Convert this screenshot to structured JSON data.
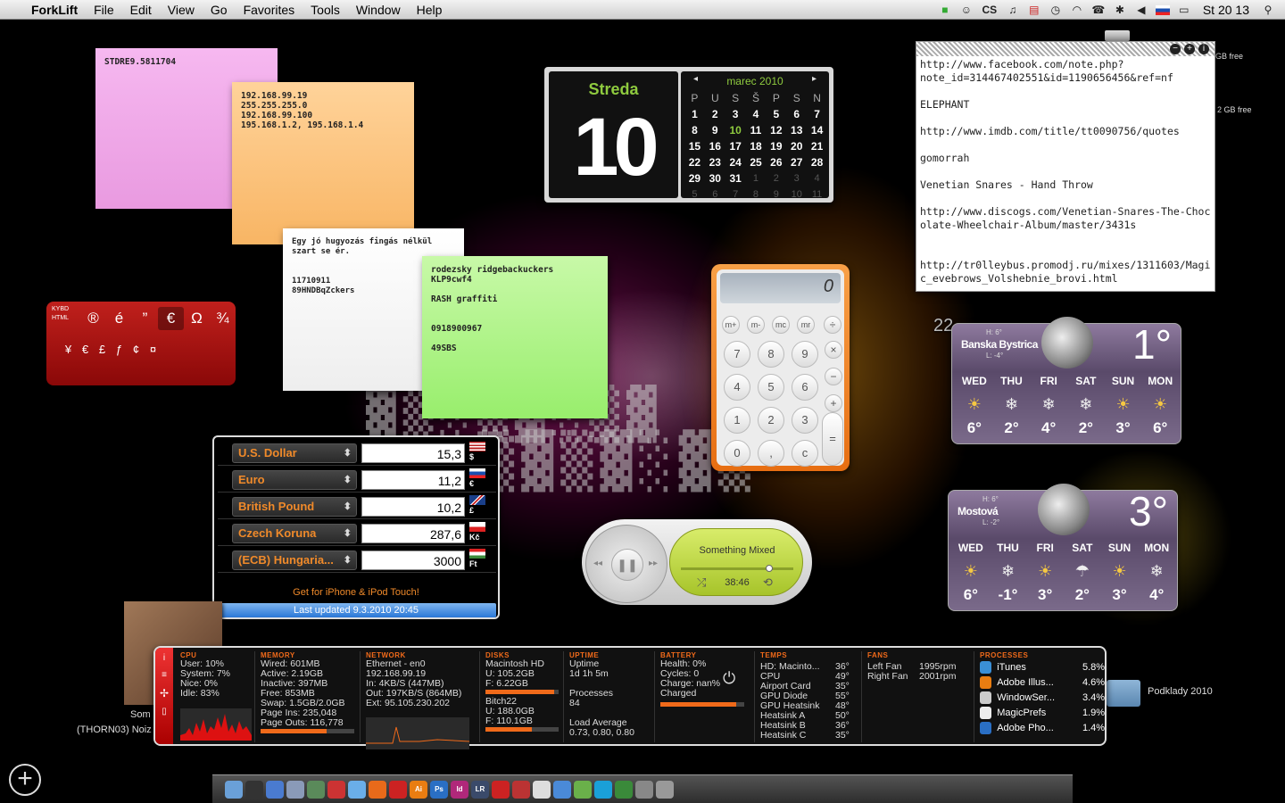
{
  "menubar": {
    "app": "ForkLift",
    "items": [
      "File",
      "Edit",
      "View",
      "Go",
      "Favorites",
      "Tools",
      "Window",
      "Help"
    ],
    "tray": [
      "evernote-icon",
      "robot-icon",
      "CS",
      "music-note-icon",
      "flag-icon",
      "clock-icon",
      "wifi-icon",
      "phone-icon",
      "bluetooth-icon",
      "volume-icon",
      "slovak-flag-icon",
      "battery-icon"
    ],
    "tray_text": "CS",
    "clock": "St 20 13"
  },
  "stickies": {
    "pink": "STDRE9.5811704",
    "orange": "192.168.99.19\n255.255.255.0\n192.168.99.100\n195.168.1.2, 195.168.1.4",
    "white": "Egy jó hugyozás fingás nélkül szart se ér.\n\n\n11710911\n89HNDBqZckers",
    "green": "rodezsky ridgebackuckers\nKLP9cwf4\n\nRASH graffiti\n\n\n0918900967\n\n49SBS"
  },
  "calendar": {
    "day_name": "Streda",
    "day_num": "10",
    "month_title": "marec 2010",
    "prev": "◂",
    "next": "▸",
    "headers": [
      "P",
      "U",
      "S",
      "Š",
      "P",
      "S",
      "N"
    ],
    "weeks": [
      [
        "1",
        "2",
        "3",
        "4",
        "5",
        "6",
        "7"
      ],
      [
        "8",
        "9",
        "10",
        "11",
        "12",
        "13",
        "14"
      ],
      [
        "15",
        "16",
        "17",
        "18",
        "19",
        "20",
        "21"
      ],
      [
        "22",
        "23",
        "24",
        "25",
        "26",
        "27",
        "28"
      ],
      [
        "29",
        "30",
        "31",
        "1",
        "2",
        "3",
        "4"
      ],
      [
        "5",
        "6",
        "7",
        "8",
        "9",
        "10",
        "11"
      ]
    ],
    "today": "10"
  },
  "notes": {
    "text": "http://www.facebook.com/note.php?\nnote_id=314467402551&id=1190656456&ref=nf\n\nELEPHANT\n\nhttp://www.imdb.com/title/tt0090756/quotes\n\ngomorrah\n\nVenetian Snares - Hand Throw\n\nhttp://www.discogs.com/Venetian-Snares-The-Chocolate-Wheelchair-Album/master/3431s\n\n\nhttp://tr0lleybus.promodj.ru/mixes/1311603/Magic_evebrows_Volshebnie_brovi.html"
  },
  "desktop_free": [
    "GB free",
    "2 GB free"
  ],
  "ascii": {
    "tags": [
      "KYBD",
      "HTML"
    ],
    "row1": [
      "®",
      "é",
      "”",
      "€",
      "Ω",
      "¾"
    ],
    "selected": "€",
    "row2": [
      "¥",
      "€",
      "£",
      "ƒ",
      "¢",
      "¤"
    ]
  },
  "calculator": {
    "display": "0",
    "mem_keys": [
      "m+",
      "m-",
      "mc",
      "mr"
    ],
    "ops": [
      "÷",
      "×",
      "−",
      "+",
      "="
    ],
    "digits": [
      "7",
      "8",
      "9",
      "4",
      "5",
      "6",
      "1",
      "2",
      "3",
      "0",
      ",",
      "c"
    ]
  },
  "currency": {
    "rows": [
      {
        "name": "U.S. Dollar",
        "value": "15,3",
        "symbol": "$"
      },
      {
        "name": "Euro",
        "value": "11,2",
        "symbol": "€"
      },
      {
        "name": "British Pound",
        "value": "10,2",
        "symbol": "£"
      },
      {
        "name": "Czech Koruna",
        "value": "287,6",
        "symbol": "Kč"
      },
      {
        "name": "(ECB) Hungaria...",
        "value": "3000",
        "symbol": "Ft"
      }
    ],
    "promo": "Get for iPhone & iPod Touch!",
    "updated": "Last updated 9.3.2010 20:45"
  },
  "itunes": {
    "track": "Something Mixed",
    "time": "38:46",
    "progress": 0.75,
    "prev": "◂◂",
    "play": "❚❚",
    "next": "▸▸",
    "shuffle": "⤮",
    "repeat": "⟲"
  },
  "weather": [
    {
      "city": "Banska Bystrica",
      "hi": "H: 6°",
      "lo": "L: -4°",
      "temp": "1°",
      "days": [
        "WED",
        "THU",
        "FRI",
        "SAT",
        "SUN",
        "MON"
      ],
      "icons": [
        "☀",
        "❄",
        "❄",
        "❄",
        "☀",
        "☀"
      ],
      "temps": [
        "6°",
        "2°",
        "4°",
        "2°",
        "3°",
        "6°"
      ]
    },
    {
      "city": "Mostová",
      "hi": "H: 6°",
      "lo": "L: -2°",
      "temp": "3°",
      "days": [
        "WED",
        "THU",
        "FRI",
        "SAT",
        "SUN",
        "MON"
      ],
      "icons": [
        "☀",
        "❄",
        "☀",
        "☂",
        "☀",
        "❄"
      ],
      "temps": [
        "6°",
        "-1°",
        "3°",
        "2°",
        "3°",
        "4°"
      ]
    }
  ],
  "weather_wall_number": "22",
  "istat": {
    "cpu": {
      "h": "CPU",
      "t": "User: 10%\nSystem: 7%\nNice: 0%\nIdle: 83%"
    },
    "memory": {
      "h": "MEMORY",
      "t": "Wired: 601MB\nActive: 2.19GB\nInactive: 397MB\nFree: 853MB\nSwap: 1.5GB/2.0GB\nPage Ins: 235,048\nPage Outs: 116,778",
      "bar": 0.7
    },
    "network": {
      "h": "NETWORK",
      "t": "Ethernet - en0\n192.168.99.19\nIn: 4KB/S (447MB)\nOut: 197KB/S (864MB)\nExt: 95.105.230.202"
    },
    "disks": {
      "h": "DISKS",
      "t1": "Macintosh HD\nU: 105.2GB\nF: 6.22GB",
      "bar1": 0.94,
      "t2": "Bitch22\nU: 188.0GB\nF: 110.1GB",
      "bar2": 0.63
    },
    "uptime": {
      "h": "UPTIME",
      "t": "Uptime\n1d 1h 5m\n\nProcesses\n84\n\nLoad Average\n0.73, 0.80, 0.80"
    },
    "battery": {
      "h": "BATTERY",
      "t": "Health: 0%\nCycles: 0\nCharge: nan%\nCharged",
      "bar": 0.9
    },
    "temps": {
      "h": "TEMPS",
      "names": "HD: Macinto...\nCPU\nAirport Card\nGPU Diode\nGPU Heatsink\nHeatsink A\nHeatsink B\nHeatsink C",
      "values": "36°\n49°\n35°\n55°\n48°\n50°\n36°\n35°"
    },
    "fans": {
      "h": "FANS",
      "names": "Left Fan\nRight Fan",
      "values": "1995rpm\n2001rpm"
    },
    "processes": {
      "h": "PROCESSES",
      "rows": [
        {
          "name": "iTunes",
          "pct": "5.8%",
          "color": "#3a8fd6"
        },
        {
          "name": "Adobe Illus...",
          "pct": "4.6%",
          "color": "#e97d11"
        },
        {
          "name": "WindowSer...",
          "pct": "3.4%",
          "color": "#cccccc"
        },
        {
          "name": "MagicPrefs",
          "pct": "1.9%",
          "color": "#eeeeee"
        },
        {
          "name": "Adobe Pho...",
          "pct": "1.4%",
          "color": "#2a6fc4"
        }
      ]
    }
  },
  "desktop": {
    "partial_label": "Som",
    "partial_label2": "(THORN03) Noiz",
    "folder_label": "Podklady 2010"
  },
  "dock": [
    "finder",
    "dash",
    "safari",
    "mail",
    "photo",
    "ical",
    "itunes",
    "firefox",
    "opera",
    "ai",
    "ps",
    "id",
    "lr",
    "acrobat",
    "pdf",
    "textedit",
    "safari2",
    "ichat",
    "skype",
    "adium",
    "prefs",
    "trash"
  ],
  "dock_labels": [
    "Ai",
    "Ps",
    "Id",
    "LR"
  ]
}
